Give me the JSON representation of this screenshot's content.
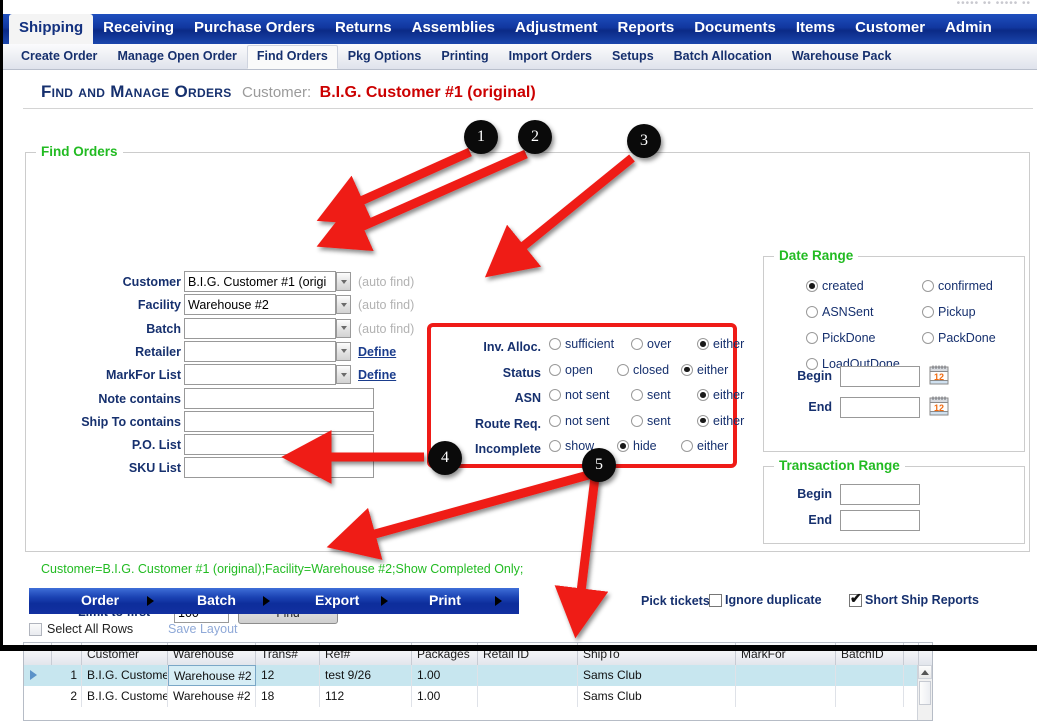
{
  "window": {
    "faint_top_text": "••••• •• •••••  ••"
  },
  "main_nav": {
    "items": [
      {
        "label": "Shipping",
        "active": true
      },
      {
        "label": "Receiving",
        "active": false
      },
      {
        "label": "Purchase Orders",
        "active": false
      },
      {
        "label": "Returns",
        "active": false
      },
      {
        "label": "Assemblies",
        "active": false
      },
      {
        "label": "Adjustment",
        "active": false
      },
      {
        "label": "Reports",
        "active": false
      },
      {
        "label": "Documents",
        "active": false
      },
      {
        "label": "Items",
        "active": false
      },
      {
        "label": "Customer",
        "active": false
      },
      {
        "label": "Admin",
        "active": false
      }
    ]
  },
  "sub_nav": {
    "items": [
      {
        "label": "Create Order",
        "active": false
      },
      {
        "label": "Manage Open Order",
        "active": false
      },
      {
        "label": "Find Orders",
        "active": true
      },
      {
        "label": "Pkg Options",
        "active": false
      },
      {
        "label": "Printing",
        "active": false
      },
      {
        "label": "Import Orders",
        "active": false
      },
      {
        "label": "Setups",
        "active": false
      },
      {
        "label": "Batch Allocation",
        "active": false
      },
      {
        "label": "Warehouse Pack",
        "active": false
      }
    ]
  },
  "page_title": {
    "heading": "Find and Manage Orders",
    "customer_label": "Customer:",
    "customer_value": "B.I.G. Customer #1 (original)"
  },
  "find_orders": {
    "legend": "Find Orders",
    "fields": [
      {
        "label": "Customer",
        "value": "B.I.G. Customer #1 (origi",
        "combo": true,
        "hint": "(auto find)",
        "hint_type": "text"
      },
      {
        "label": "Facility",
        "value": "Warehouse #2",
        "combo": true,
        "hint": "(auto find)",
        "hint_type": "text"
      },
      {
        "label": "Batch",
        "value": "",
        "combo": true,
        "hint": "(auto find)",
        "hint_type": "text"
      },
      {
        "label": "Retailer",
        "value": "",
        "combo": true,
        "hint": "Define",
        "hint_type": "link"
      },
      {
        "label": "MarkFor List",
        "value": "",
        "combo": true,
        "hint": "Define",
        "hint_type": "link"
      },
      {
        "label": "Note contains",
        "value": "",
        "combo": false,
        "hint": "",
        "hint_type": "none"
      },
      {
        "label": "Ship To contains",
        "value": "",
        "combo": false,
        "hint": "",
        "hint_type": "none"
      },
      {
        "label": "P.O. List",
        "value": "",
        "combo": false,
        "hint": "",
        "hint_type": "none"
      },
      {
        "label": "SKU List",
        "value": "",
        "combo": false,
        "hint": "",
        "hint_type": "none"
      }
    ],
    "limit_label": "Limit to first",
    "limit_value": "100",
    "find_button": "Find"
  },
  "filters": {
    "rows": [
      {
        "label": "Inv. Alloc.",
        "options": [
          {
            "label": "sufficient",
            "selected": false
          },
          {
            "label": "over",
            "selected": false
          },
          {
            "label": "either",
            "selected": true
          }
        ]
      },
      {
        "label": "Status",
        "options": [
          {
            "label": "open",
            "selected": false
          },
          {
            "label": "closed",
            "selected": false
          },
          {
            "label": "either",
            "selected": true
          }
        ]
      },
      {
        "label": "ASN",
        "options": [
          {
            "label": "not sent",
            "selected": false
          },
          {
            "label": "sent",
            "selected": false
          },
          {
            "label": "either",
            "selected": true
          }
        ]
      },
      {
        "label": "Route Req.",
        "options": [
          {
            "label": "not sent",
            "selected": false
          },
          {
            "label": "sent",
            "selected": false
          },
          {
            "label": "either",
            "selected": true
          }
        ]
      },
      {
        "label": "Incomplete",
        "options": [
          {
            "label": "show",
            "selected": false
          },
          {
            "label": "hide",
            "selected": true
          },
          {
            "label": "either",
            "selected": false
          }
        ]
      }
    ]
  },
  "date_range": {
    "legend": "Date Range",
    "options": [
      {
        "label": "created",
        "selected": true
      },
      {
        "label": "confirmed",
        "selected": false
      },
      {
        "label": "ASNSent",
        "selected": false
      },
      {
        "label": "Pickup",
        "selected": false
      },
      {
        "label": "PickDone",
        "selected": false
      },
      {
        "label": "PackDone",
        "selected": false
      },
      {
        "label": "LoadOutDone",
        "selected": false
      }
    ],
    "begin_label": "Begin",
    "begin_value": "",
    "end_label": "End",
    "end_value": "",
    "calendar_icon_day": "12"
  },
  "transaction_range": {
    "legend": "Transaction Range",
    "begin_label": "Begin",
    "begin_value": "",
    "end_label": "End",
    "end_value": ""
  },
  "status_line": "Customer=B.I.G. Customer #1 (original);Facility=Warehouse #2;Show Completed Only;",
  "action_bar": {
    "items": [
      {
        "label": "Order"
      },
      {
        "label": "Batch"
      },
      {
        "label": "Export"
      },
      {
        "label": "Print"
      }
    ]
  },
  "pick_tickets": {
    "label": "Pick tickets:",
    "ignore_duplicate": {
      "label": "Ignore duplicate",
      "checked": false
    },
    "short_ship_reports": {
      "label": "Short Ship Reports",
      "checked": true
    }
  },
  "select_all_rows": {
    "label": "Select All Rows",
    "checked": false
  },
  "save_layout": {
    "label": "Save Layout"
  },
  "grid": {
    "columns": [
      "Customer",
      "Warehouse",
      "Trans#",
      "Ref#",
      "Packages",
      "Retail ID",
      "ShipTo",
      "MarkFor",
      "BatchID"
    ],
    "rows": [
      {
        "num": "1",
        "selected": true,
        "cells": [
          "B.I.G. Custome",
          "Warehouse #2",
          "12",
          "test 9/26",
          "1.00",
          "",
          "Sams Club",
          "",
          ""
        ]
      },
      {
        "num": "2",
        "selected": false,
        "cells": [
          "B.I.G. Custome",
          "Warehouse #2",
          "18",
          "112",
          "1.00",
          "",
          "Sams Club",
          "",
          ""
        ]
      }
    ]
  },
  "annotations": {
    "accent_color": "#ef1b17",
    "badges": [
      {
        "number": "1"
      },
      {
        "number": "2"
      },
      {
        "number": "3"
      },
      {
        "number": "4"
      },
      {
        "number": "5"
      }
    ]
  }
}
